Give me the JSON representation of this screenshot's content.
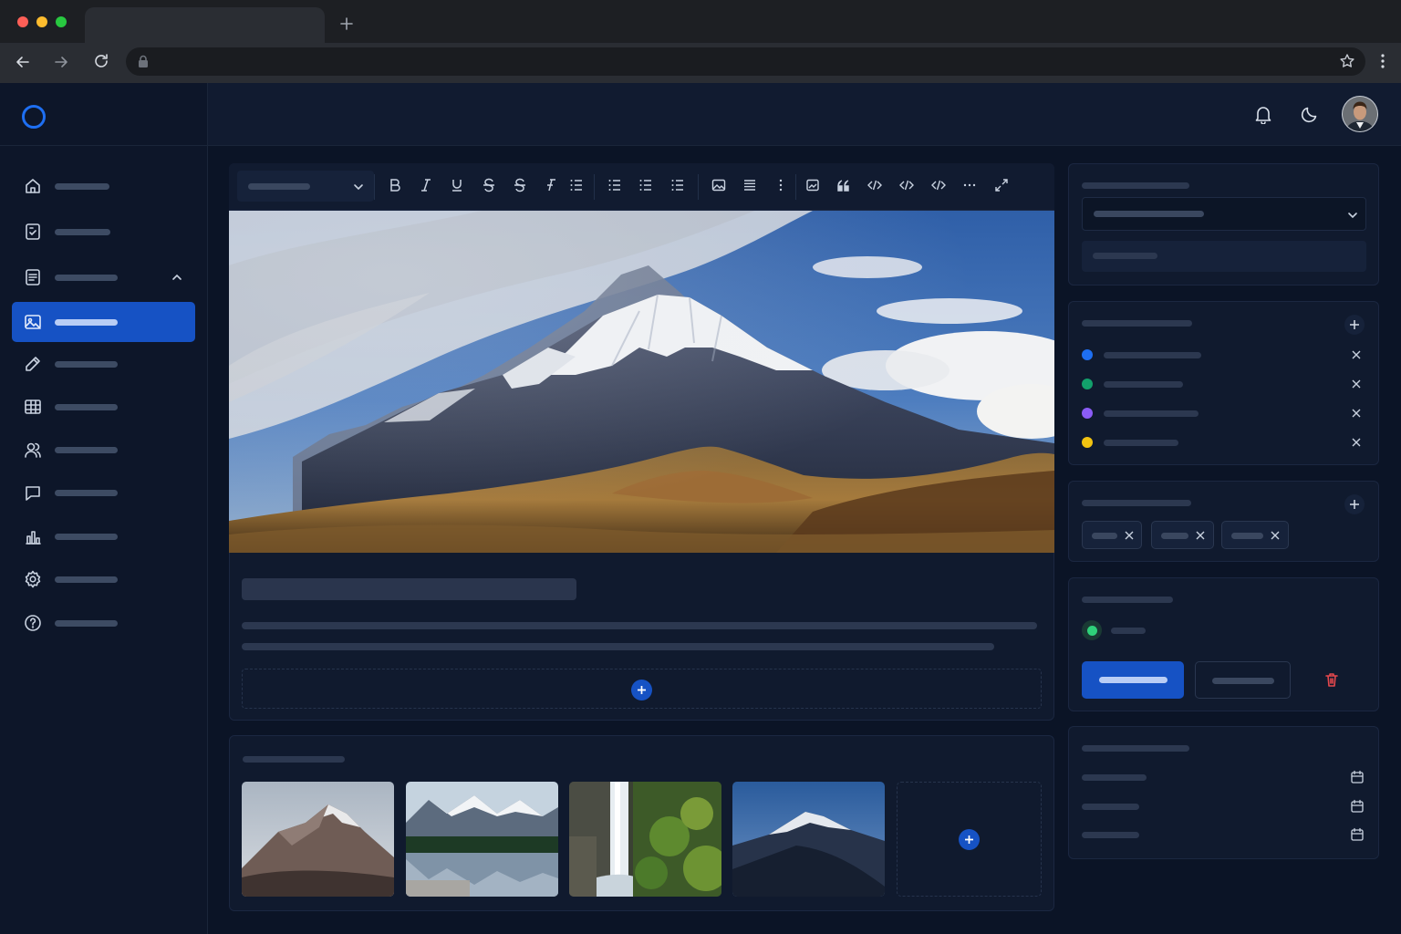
{
  "browser": {
    "tab_title": "",
    "url": "",
    "icons": [
      "back-arrow-icon",
      "forward-arrow-icon",
      "reload-icon",
      "lock-icon",
      "star-icon",
      "kebab-menu-icon",
      "new-tab-plus-icon"
    ]
  },
  "app": {
    "logo": "ring-logo",
    "colors": {
      "accent": "#1652c4",
      "background": "#0b1426",
      "panel": "#101a2e",
      "danger": "#e5484d"
    }
  },
  "sidebar": {
    "items": [
      {
        "icon": "home-icon",
        "label": ""
      },
      {
        "icon": "document-icon",
        "label": ""
      },
      {
        "icon": "file-text-icon",
        "label": "",
        "expanded": true
      },
      {
        "icon": "image-icon",
        "label": "",
        "active": true
      },
      {
        "icon": "pencil-icon",
        "label": ""
      },
      {
        "icon": "table-icon",
        "label": ""
      },
      {
        "icon": "users-icon",
        "label": ""
      },
      {
        "icon": "chat-icon",
        "label": ""
      },
      {
        "icon": "bar-chart-icon",
        "label": ""
      },
      {
        "icon": "gear-icon",
        "label": ""
      },
      {
        "icon": "help-icon",
        "label": ""
      }
    ]
  },
  "header": {
    "icons": [
      "bell-icon",
      "moon-icon",
      "avatar"
    ]
  },
  "editor": {
    "block_type_select": "",
    "toolbar_icons": [
      "bold-icon",
      "italic-icon",
      "underline-icon",
      "strikethrough-icon",
      "strikethrough-alt-icon",
      "clear-format-icon",
      "list-icon",
      "bullet-list-icon",
      "numbered-list-icon",
      "checklist-icon",
      "image-icon",
      "align-icon",
      "more-vertical-icon",
      "embed-image-icon",
      "quote-icon",
      "code-icon",
      "code-block-icon",
      "html-icon",
      "more-horizontal-icon",
      "expand-icon"
    ],
    "title": "",
    "body": "",
    "add_block": "+"
  },
  "gallery": {
    "heading": "",
    "images": [
      "mountain",
      "lake-mountains",
      "waterfall",
      "night-mountain"
    ],
    "add": "+"
  },
  "right_panel": {
    "select_card": {
      "label": "",
      "select_value": "",
      "input_value": ""
    },
    "categories": {
      "heading": "",
      "items": [
        {
          "color": "#1e6ff2",
          "label": ""
        },
        {
          "color": "#12a06b",
          "label": ""
        },
        {
          "color": "#8b5cf6",
          "label": ""
        },
        {
          "color": "#f2c311",
          "label": ""
        }
      ]
    },
    "tags": {
      "heading": "",
      "items": [
        "",
        "",
        ""
      ]
    },
    "status": {
      "heading": "",
      "status_color": "#2fd17a",
      "status_text": "",
      "primary_button": "",
      "secondary_button": ""
    },
    "schedule": {
      "heading": "",
      "rows": [
        "",
        "",
        ""
      ]
    }
  }
}
